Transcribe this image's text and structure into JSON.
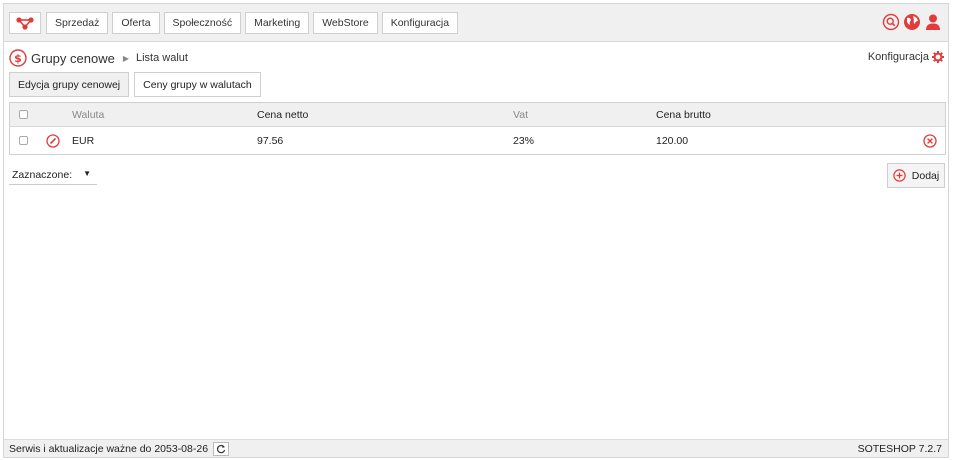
{
  "nav": {
    "items": [
      "Sprzedaż",
      "Oferta",
      "Społeczność",
      "Marketing",
      "WebStore",
      "Konfiguracja"
    ],
    "icons": [
      "search-icon",
      "globe-icon",
      "user-icon"
    ]
  },
  "breadcrumb": {
    "title": "Grupy cenowe",
    "current": "Lista walut"
  },
  "config_link": "Konfiguracja",
  "tabs": [
    "Edycja grupy cenowej",
    "Ceny grupy w walutach"
  ],
  "table": {
    "headers": {
      "waluta": "Waluta",
      "netto": "Cena netto",
      "vat": "Vat",
      "brutto": "Cena brutto"
    },
    "rows": [
      {
        "waluta": "EUR",
        "netto": "97.56",
        "vat": "23%",
        "brutto": "120.00"
      }
    ]
  },
  "bulk_action": "Zaznaczone:",
  "add_button": "Dodaj",
  "footer": {
    "service": "Serwis i aktualizacje ważne do 2053-08-26",
    "version": "SOTESHOP 7.2.7"
  },
  "colors": {
    "accent": "#e03c3c"
  }
}
